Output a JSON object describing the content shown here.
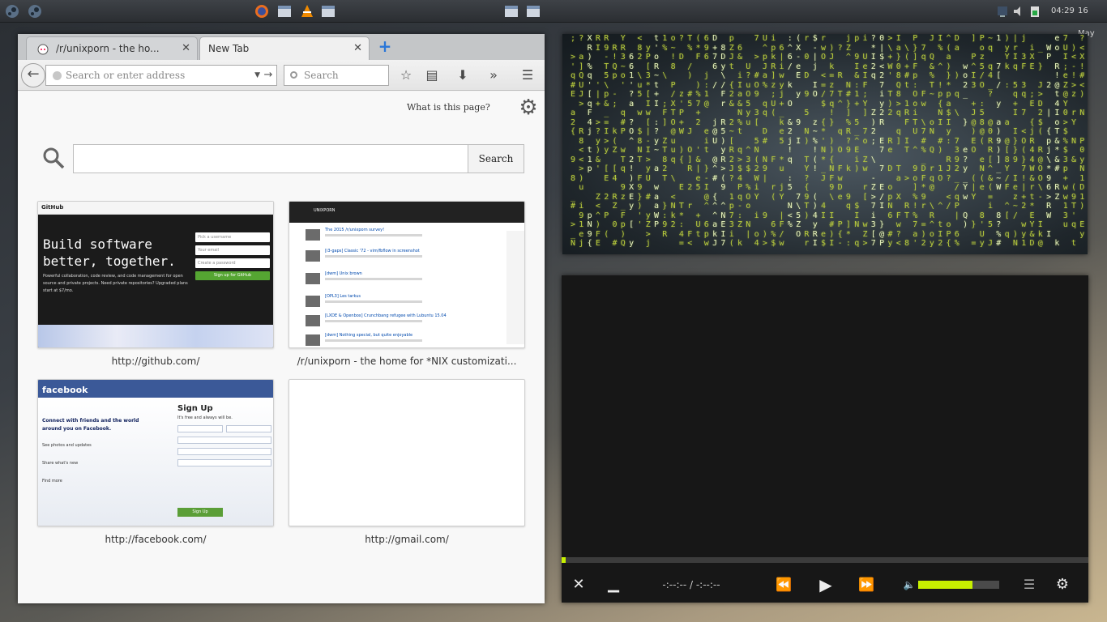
{
  "panel": {
    "clock": "04:29",
    "date": "16 May"
  },
  "firefox": {
    "tabs": [
      {
        "label": "/r/unixporn - the ho...",
        "close": "✕"
      },
      {
        "label": "New Tab",
        "close": "✕"
      }
    ],
    "newtab_label": "+",
    "url_placeholder": "Search or enter address",
    "search_placeholder": "Search",
    "what_is_this": "What is this page?",
    "search_button": "Search",
    "tiles": [
      {
        "label": "http://github.com/",
        "hero": "Build software better, together.",
        "subtext": "Powerful collaboration, code review, and code management for open source and private projects. Need private repositories? Upgraded plans start at $7/mo.",
        "fields": [
          "Pick a username",
          "Your email",
          "Create a password"
        ],
        "cta": "Sign up for GitHub",
        "nav": "GitHub"
      },
      {
        "label": "/r/unixporn - the home for *NIX customizati...",
        "posts": [
          "The 2015 /r/unixporn survey!",
          "[i3-gaps] Classic '72 - vim/fbflow in screenshot",
          "[dwm] Unix brown",
          "[OPL3] Les tarkus",
          "[LXDE & Openbox] Crunchbang refugee with Lubuntu 15.04",
          "[dwm] Nothing special, but quite enjoyable"
        ],
        "nav_title": "UNIXPORN"
      },
      {
        "label": "http://facebook.com/",
        "logo": "facebook",
        "headline": "Connect with friends and the world around you on Facebook.",
        "signup": "Sign Up",
        "signup_sub": "It's free and always will be.",
        "features": [
          "See photos and updates",
          "Share what's new",
          "Find more"
        ],
        "button": "Sign Up"
      },
      {
        "label": "http://gmail.com/"
      }
    ]
  },
  "player": {
    "time": "-:--:-- / -:--:--",
    "progress_fraction": 0.0,
    "volume_fraction": 0.67,
    "accent": "#c7f000"
  },
  "colors": {
    "matrix_green": "#b9cc3d",
    "firefox_blue": "#2a76d8"
  }
}
